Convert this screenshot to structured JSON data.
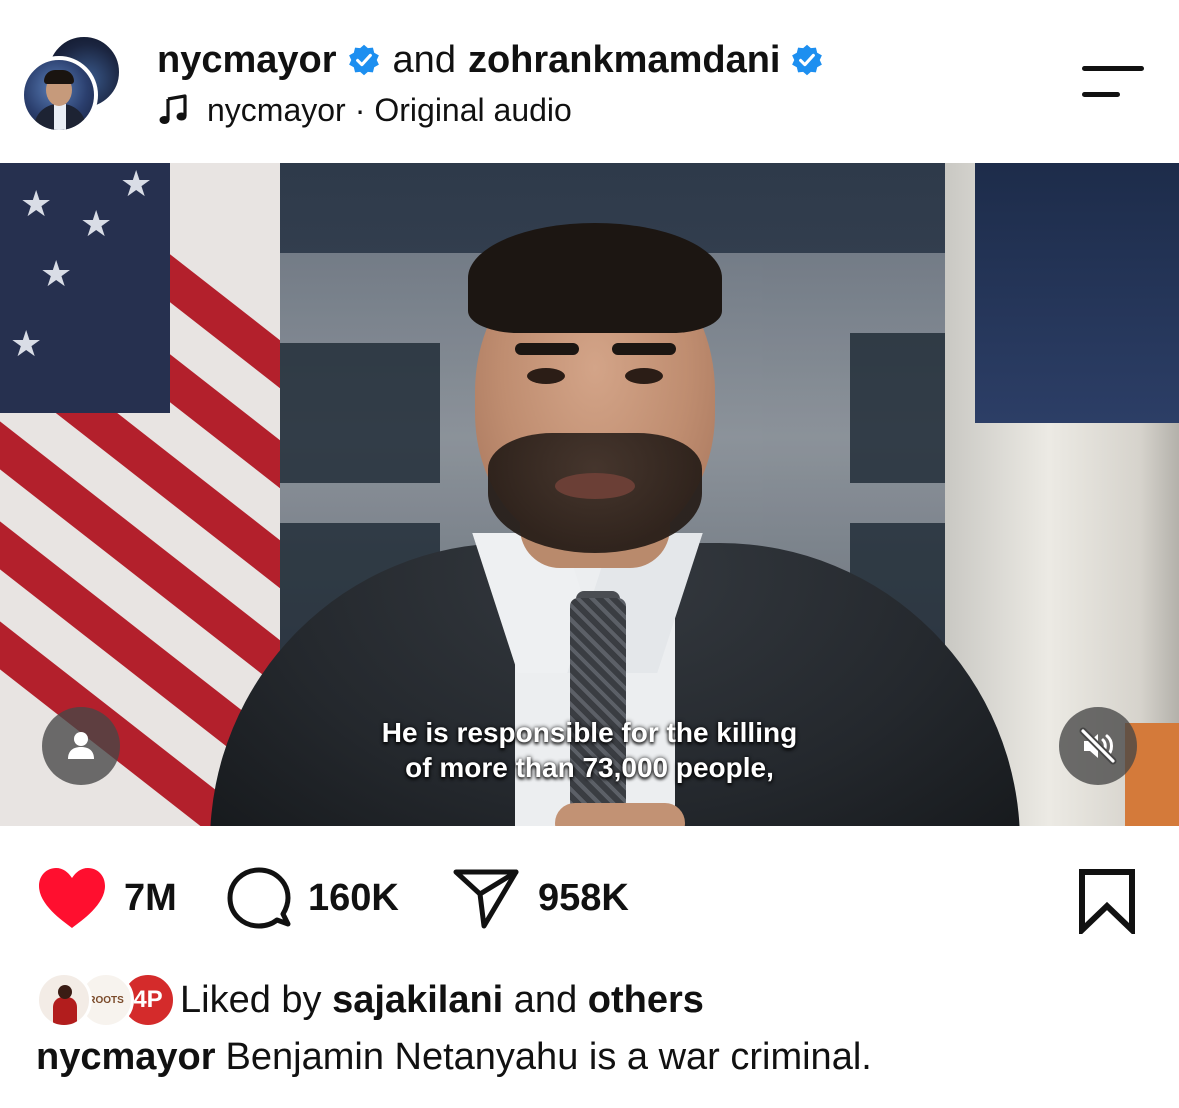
{
  "post": {
    "author": "nycmayor",
    "connector": "and",
    "collaborator": "zohrankmamdani",
    "audio_owner": "nycmayor",
    "audio_separator": "·",
    "audio_label": "Original audio"
  },
  "video": {
    "subtitle_line1": "He is responsible for the killing",
    "subtitle_line2": "of more than 73,000 people,",
    "muted": true
  },
  "actions": {
    "likes": "7M",
    "comments": "160K",
    "shares": "958K"
  },
  "liked_by": {
    "prefix": "Liked by",
    "user": "sajakilani",
    "joiner": "and",
    "suffix": "others",
    "avatar2_text": "ROOTS",
    "avatar3_text": "4P"
  },
  "caption": {
    "username": "nycmayor",
    "text": "Benjamin Netanyahu is a war criminal."
  },
  "colors": {
    "like_red": "#ff0f2f",
    "verified_blue": "#1d8ff0",
    "text": "#111111"
  }
}
